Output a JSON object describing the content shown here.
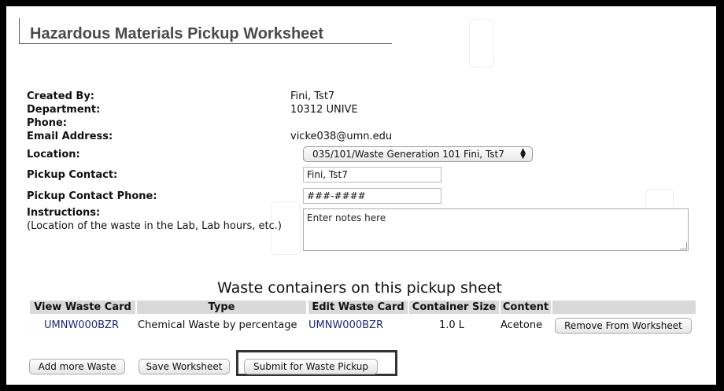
{
  "page": {
    "title": "Hazardous Materials Pickup Worksheet"
  },
  "form": {
    "created_by": {
      "label": "Created By:",
      "value": "Fini, Tst7"
    },
    "department": {
      "label": "Department:",
      "value": "10312 UNIVE"
    },
    "phone": {
      "label": "Phone:",
      "value": ""
    },
    "email": {
      "label": "Email Address:",
      "value": "vicke038@umn.edu"
    },
    "location": {
      "label": "Location:",
      "selected": "035/101/Waste Generation 101 Fini, Tst7"
    },
    "pickup_contact": {
      "label": "Pickup Contact:",
      "value": "Fini, Tst7"
    },
    "pickup_phone": {
      "label": "Pickup Contact Phone:",
      "value": "###-####"
    },
    "instructions": {
      "label": "Instructions:",
      "hint": "(Location of the waste in the Lab, Lab hours, etc.)",
      "placeholder": "Enter notes here"
    }
  },
  "table": {
    "title": "Waste containers on this pickup sheet",
    "headers": [
      "View Waste Card",
      "Type",
      "Edit Waste Card",
      "Container Size",
      "Content"
    ],
    "rows": [
      {
        "view_card": "UMNW000BZR",
        "type": "Chemical Waste by percentage",
        "edit_card": "UMNW000BZR",
        "size": "1.0 L",
        "content": "Acetone",
        "remove_label": "Remove From Worksheet"
      }
    ]
  },
  "actions": {
    "add_more": "Add more Waste",
    "save": "Save Worksheet",
    "submit": "Submit for Waste Pickup"
  }
}
